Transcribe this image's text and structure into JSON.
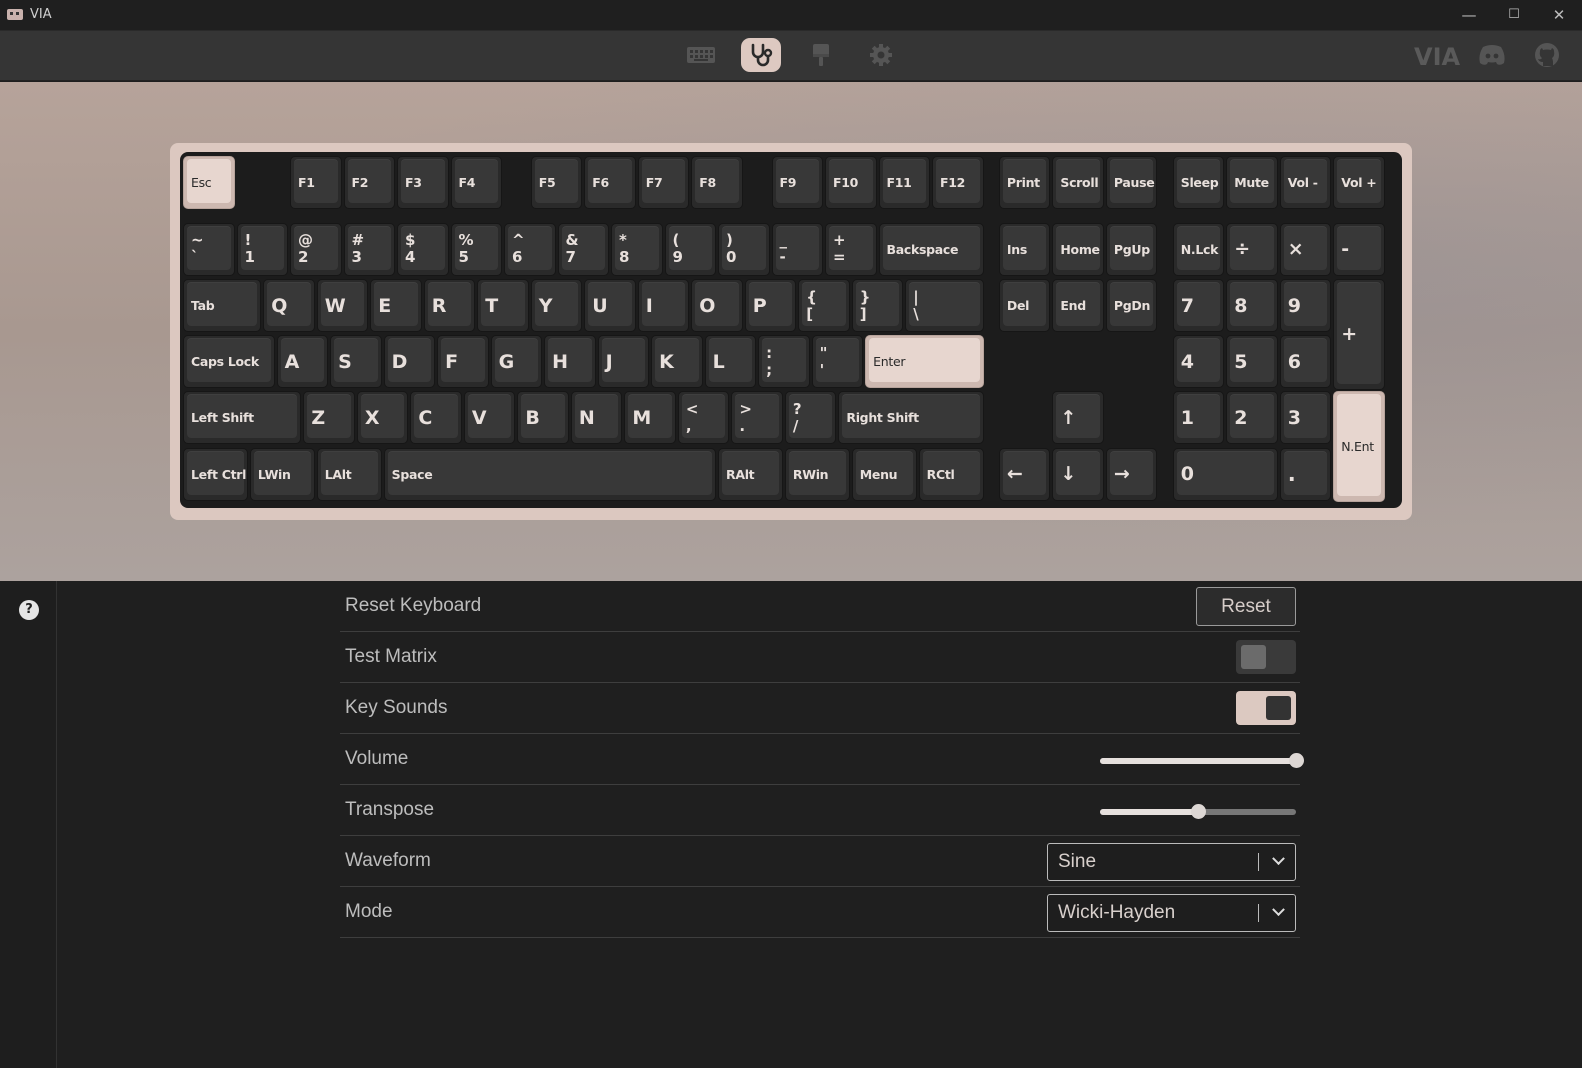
{
  "window": {
    "title": "VIA",
    "minimize": "—",
    "maximize": "☐",
    "close": "✕"
  },
  "nav": {
    "items": [
      {
        "icon": "keyboard-icon",
        "label": "Configure"
      },
      {
        "icon": "stethoscope-icon",
        "label": "Test",
        "active": true
      },
      {
        "icon": "paintbrush-icon",
        "label": "Design"
      },
      {
        "icon": "gear-icon",
        "label": "Settings"
      }
    ],
    "brand": "VIA",
    "links": [
      "discord-icon",
      "github-icon"
    ]
  },
  "keyboard": {
    "keys": [
      "Esc",
      "F1",
      "F2",
      "F3",
      "F4",
      "F5",
      "F6",
      "F7",
      "F8",
      "F9",
      "F10",
      "F11",
      "F12",
      "Print",
      "Scroll",
      "Pause",
      "Sleep",
      "Mute",
      "Vol -",
      "Vol +",
      "~\n`",
      "!\n1",
      "@\n2",
      "#\n3",
      "$\n4",
      "%\n5",
      "^\n6",
      "&\n7",
      "*\n8",
      "(\n9",
      ")\n0",
      "_\n-",
      "+\n=",
      "Backspace",
      "Ins",
      "Home",
      "PgUp",
      "N.Lck",
      "÷",
      "×",
      "-",
      "Tab",
      "Q",
      "W",
      "E",
      "R",
      "T",
      "Y",
      "U",
      "I",
      "O",
      "P",
      "{\n[",
      "}\n]",
      "|\n\\",
      "Del",
      "End",
      "PgDn",
      "7",
      "8",
      "9",
      "+",
      "Caps Lock",
      "A",
      "S",
      "D",
      "F",
      "G",
      "H",
      "J",
      "K",
      "L",
      ":\n;",
      "\"\n'",
      "Enter",
      "4",
      "5",
      "6",
      "Left Shift",
      "Z",
      "X",
      "C",
      "V",
      "B",
      "N",
      "M",
      "<\n,",
      ">\n.",
      "?\n/",
      "Right Shift",
      "↑",
      "1",
      "2",
      "3",
      "N.Ent",
      "Left Ctrl",
      "LWin",
      "LAlt",
      "Space",
      "RAlt",
      "RWin",
      "Menu",
      "RCtl",
      "←",
      "↓",
      "→",
      "0",
      "."
    ],
    "pressed": [
      "Esc",
      "Enter",
      "N.Ent"
    ],
    "accent_color": "#e7d6cf",
    "cap_color": "#383838"
  },
  "settings": {
    "help_icon": "?",
    "reset_label": "Reset Keyboard",
    "reset_button": "Reset",
    "test_matrix_label": "Test Matrix",
    "test_matrix_on": false,
    "key_sounds_label": "Key Sounds",
    "key_sounds_on": true,
    "volume_label": "Volume",
    "volume_value": 1.0,
    "transpose_label": "Transpose",
    "transpose_value": 0.5,
    "waveform_label": "Waveform",
    "waveform_value": "Sine",
    "mode_label": "Mode",
    "mode_value": "Wicki-Hayden"
  }
}
